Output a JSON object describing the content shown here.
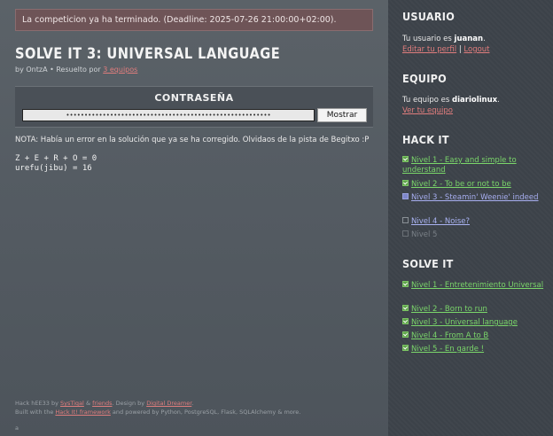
{
  "alert": "La competicion ya ha terminado. (Deadline: 2025-07-26 21:00:00+02:00).",
  "challenge": {
    "title": "SOLVE IT 3: UNIVERSAL LANGUAGE",
    "by_prefix": "by",
    "author": "OntzA",
    "solved_text": "• Resuelto por",
    "solved_count": "3 equipos",
    "password_title": "CONTRASEÑA",
    "password_mask": "••••••••••••••••••••••••••••••••••••••••••••••••••••••••",
    "show_button": "Mostrar",
    "note": "NOTA: Había un error en la solución que ya se ha corregido. Olvidaos de la pista de Begitxo :P",
    "code": "Z + E + R + O = 0\nurefu(jibu) = 16"
  },
  "footer": {
    "line1_prefix": "Hack hEE33 by",
    "line1_a": "SysTiqal",
    "line1_amp": "&",
    "line1_b": "friends",
    "line1_design": ". Design by",
    "line1_c": "Digital Dreamer",
    "line1_end": ".",
    "line2_prefix": "Built with the",
    "line2_a": "Hack It! framework",
    "line2_mid": "and powered by Python, PostgreSQL, Flask, SQLAlchemy & more.",
    "version": "a"
  },
  "sidebar": {
    "usuario": {
      "heading": "USUARIO",
      "line": "Tu usuario es",
      "username": "juanan",
      "edit": "Editar tu perfil",
      "sep": "|",
      "logout": "Logout"
    },
    "equipo": {
      "heading": "EQUIPO",
      "line": "Tu equipo es",
      "team": "diariolinux",
      "link": "Ver tu equipo"
    },
    "hackit": {
      "heading": "HACK IT",
      "levels": [
        {
          "label": "Nivel 1 - Easy and simple to understand",
          "state": "done"
        },
        {
          "label": "Nivel 2 - To be or not to be",
          "state": "done"
        },
        {
          "label": "Nivel 3 - Steamin' Weenie' indeed",
          "state": "part"
        },
        {
          "label": "Nivel 4 - Noise?",
          "state": "open"
        },
        {
          "label": "Nivel 5",
          "state": "locked"
        }
      ]
    },
    "solveit": {
      "heading": "SOLVE IT",
      "levels": [
        {
          "label": "Nivel 1 - Entretenimiento Universal",
          "state": "done"
        },
        {
          "label": "Nivel 2 - Born to run",
          "state": "done"
        },
        {
          "label": "Nivel 3 - Universal language",
          "state": "done"
        },
        {
          "label": "Nivel 4 - From A to B",
          "state": "done"
        },
        {
          "label": "Nivel 5 - En garde !",
          "state": "done"
        }
      ]
    }
  },
  "colors": {
    "accent_link": "#e07d7d",
    "done_link": "#7ad66a",
    "alert_bg": "#6e5457"
  }
}
